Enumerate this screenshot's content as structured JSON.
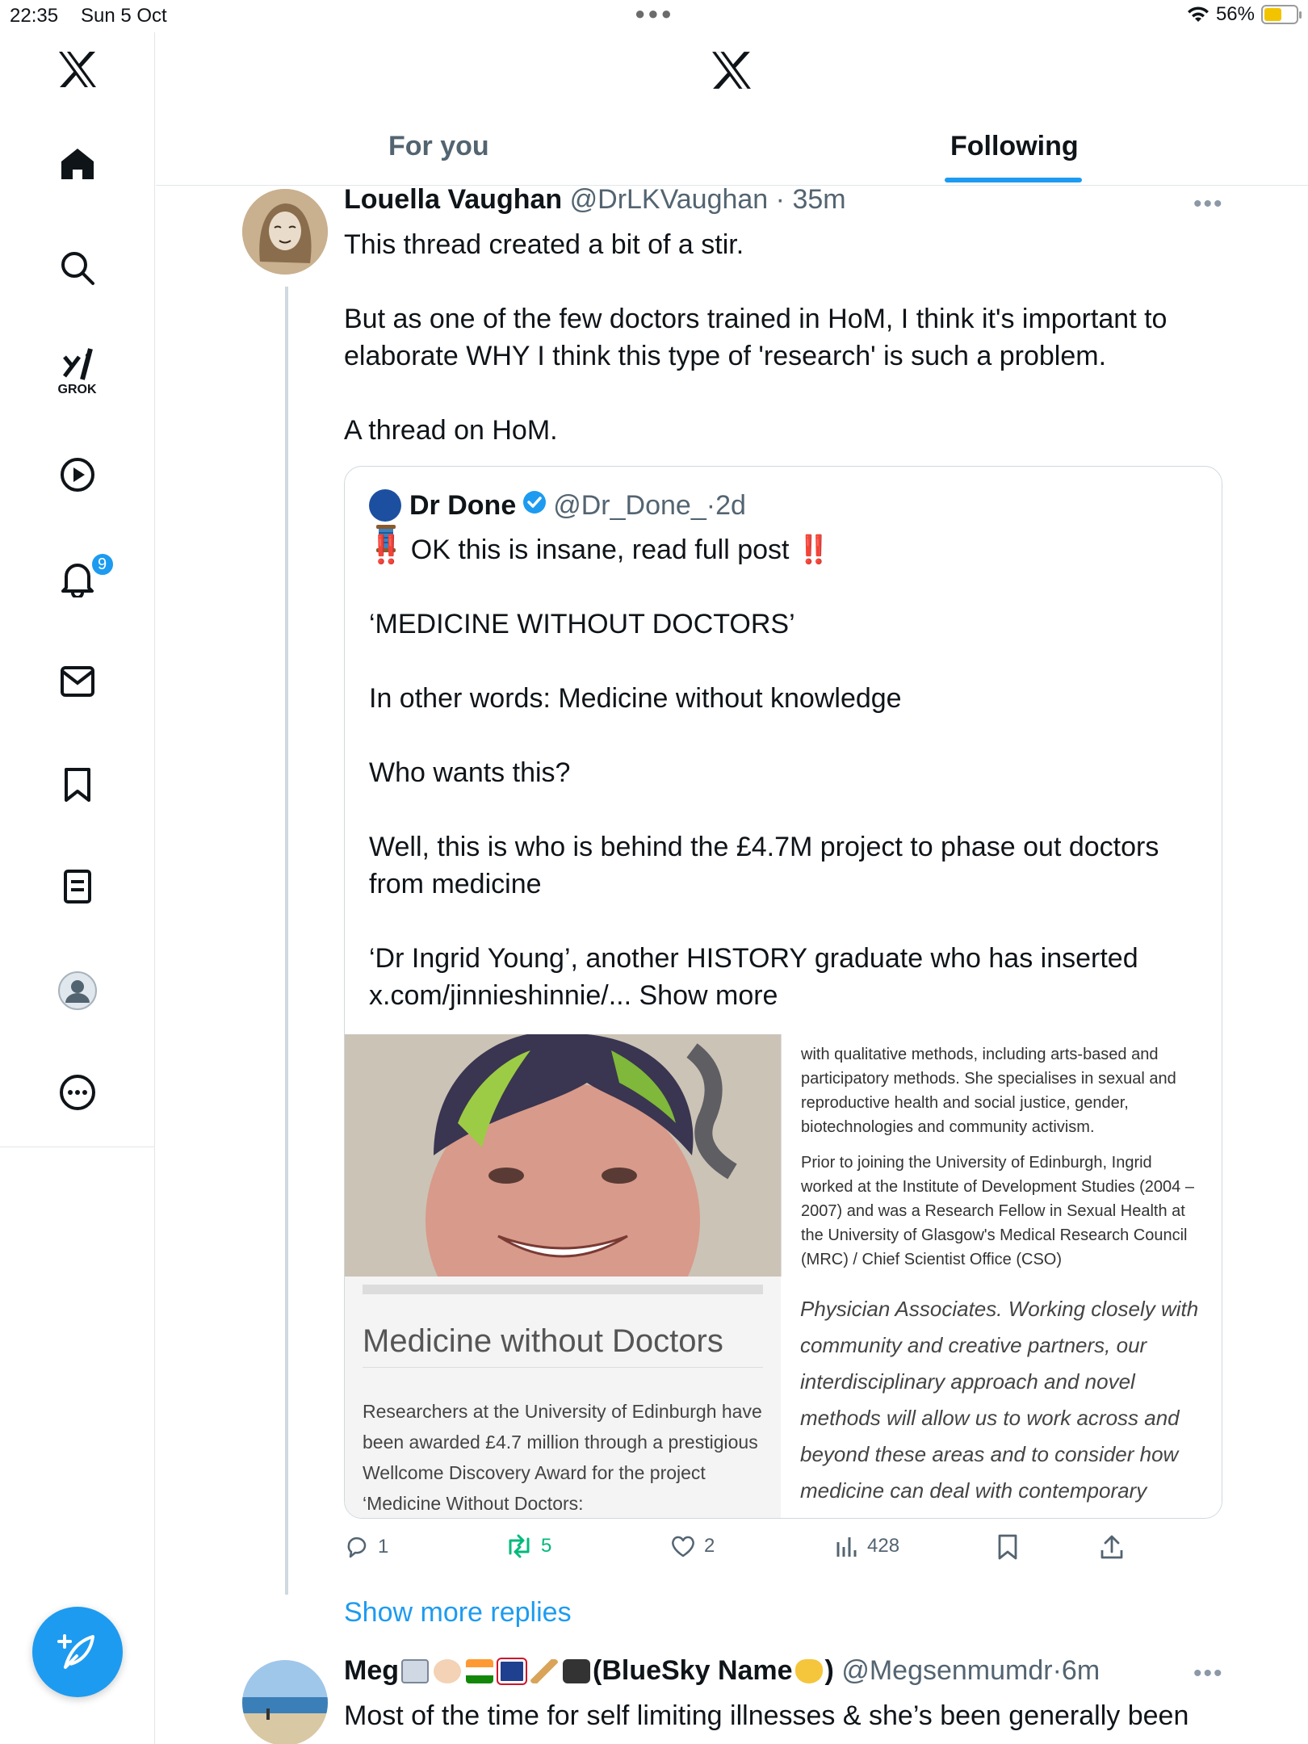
{
  "status_bar": {
    "time": "22:35",
    "date": "Sun 5 Oct",
    "battery": "56%",
    "battery_level": 0.56
  },
  "sidebar": {
    "grok_label": "GROK",
    "notification_count": "9"
  },
  "tabs": [
    {
      "label": "For you",
      "active": false
    },
    {
      "label": "Following",
      "active": true
    }
  ],
  "tweet": {
    "name": "Louella Vaughan",
    "handle": "@DrLKVaughan",
    "sep": " · ",
    "time": "35m",
    "body1": "This thread created a bit of a stir.",
    "body2": "But as one of the few doctors trained in HoM, I think it's important to elaborate WHY I think this type of 'research' is such a problem.",
    "body3": "A thread on HoM.",
    "quote": {
      "name": "Dr Done",
      "handle": "@Dr_Done_",
      "time": "2d",
      "line1": " OK this is insane, read full post ",
      "bang": "‼️",
      "line2": "‘MEDICINE WITHOUT DOCTORS’",
      "line3": "In other words: Medicine without knowledge",
      "line4": "Who wants this?",
      "line5": "Well, this is who is behind the £4.7M project to phase out doctors from medicine",
      "line6": "‘Dr Ingrid Young’, another HISTORY graduate who has inserted",
      "line7": "x.com/jinnieshinnie/... ",
      "show_more": "Show more",
      "image_text1_p1": "with qualitative methods, including arts-based and participatory methods. She specialises in sexual and reproductive health and social justice, gender, biotechnologies and community activism.",
      "image_text1_p2": "Prior to joining the University of Edinburgh, Ingrid worked at the Institute of Development Studies (2004 – 2007) and was a Research Fellow in Sexual Health at the University of Glasgow's Medical Research Council (MRC) / Chief Scientist Office (CSO)",
      "article_title": "Medicine without Doctors",
      "article_text": "Researchers at the University of Edinburgh have been awarded £4.7 million through a prestigious Wellcome Discovery Award for the project ‘Medicine Without Doctors:",
      "image_text2": "Physician Associates. Working closely with community and creative partners, our interdisciplinary approach and novel methods will allow us to work across and beyond these areas and to consider how medicine can deal with contemporary"
    },
    "actions": {
      "replies": "1",
      "retweets": "5",
      "likes": "2",
      "views": "428"
    }
  },
  "show_more_replies": "Show more replies",
  "tweet2": {
    "name": "Meg",
    "name_suffix": "(BlueSky Name",
    "name_close": ")",
    "handle": "@Megsenmumdr",
    "sep": " · ",
    "time": "6m",
    "body": "Most of the time for self limiting illnesses & she’s been generally been"
  },
  "colors": {
    "accent": "#1d9bf0",
    "retweet": "#00ba7c",
    "muted": "#536471"
  }
}
